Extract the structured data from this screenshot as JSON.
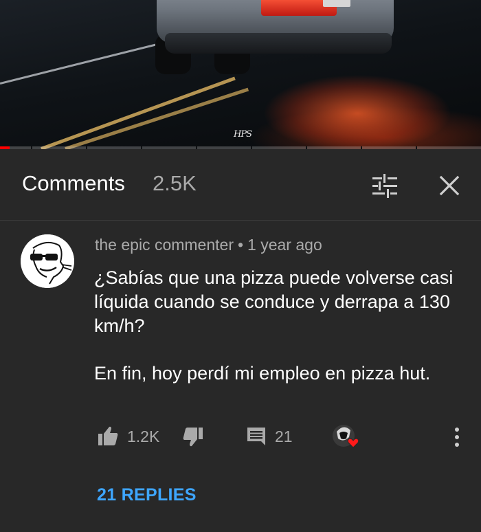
{
  "video": {
    "watermark": "HPS",
    "progress_fraction": 0.02,
    "colors": {
      "played": "#ff0000"
    }
  },
  "comments_header": {
    "title": "Comments",
    "count": "2.5K",
    "sort_icon": "sort-sliders-icon",
    "close_icon": "close-icon"
  },
  "comment": {
    "author": "the epic commenter",
    "separator": "•",
    "time": "1 year ago",
    "paragraphs": [
      "¿Sabías que una pizza puede volverse casi líquida cuando se conduce y derrapa a 130 km/h?",
      "En fin, hoy perdí mi empleo en pizza hut."
    ],
    "avatar_icon": "meme-face-avatar",
    "actions": {
      "like_count": "1.2K",
      "reply_count": "21",
      "like_icon": "thumbs-up-icon",
      "dislike_icon": "thumbs-down-icon",
      "reply_icon": "comment-icon",
      "heart_icon": "creator-heart-icon",
      "more_icon": "more-vert-icon"
    },
    "replies_label": "21 REPLIES"
  },
  "colors": {
    "background": "#282828",
    "secondary_text": "#aaaaaa",
    "link": "#3ea6ff",
    "heart": "#ff1a1a"
  }
}
